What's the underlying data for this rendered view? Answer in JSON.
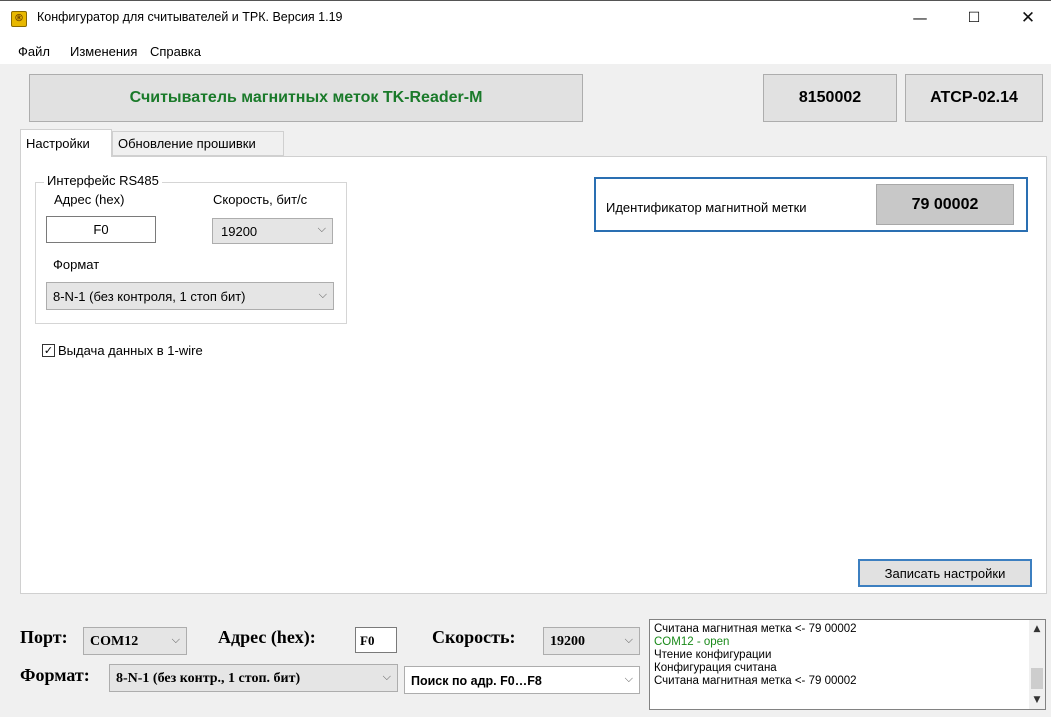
{
  "window": {
    "title": "Конфигуратор  для считывателей и ТРК.  Версия 1.19",
    "icon": "app-logo-icon",
    "minimize_glyph": "—",
    "maximize_glyph": "☐",
    "close_glyph": "✕"
  },
  "menu": {
    "file": "Файл",
    "edit": "Изменения",
    "help": "Справка"
  },
  "header": {
    "device_name": "Считыватель магнитных меток TK-Reader-M",
    "device_name_color": "#1a7a2a",
    "serial": "8150002",
    "version": "ATCP-02.14"
  },
  "tabs": [
    {
      "label": "Настройки",
      "active": true
    },
    {
      "label": "Обновление прошивки",
      "active": false
    }
  ],
  "settings": {
    "rs485_group": "Интерфейс RS485",
    "address_label": "Адрес (hex)",
    "address_value": "F0",
    "speed_label": "Скорость, бит/с",
    "speed_value": "19200",
    "format_label": "Формат",
    "format_value": "8-N-1 (без контроля, 1 стоп бит)",
    "onewire_label": "Выдача данных в 1-wire",
    "onewire_checked": true,
    "tag_label": "Идентификатор магнитной метки",
    "tag_value": "79 00002",
    "write_button": "Записать настройки"
  },
  "bottom": {
    "port_label": "Порт:",
    "port_value": "COM12",
    "address_label": "Адрес (hex):",
    "address_value": "F0",
    "speed_label": "Скорость:",
    "speed_value": "19200",
    "format_label": "Формат:",
    "format_value": "8-N-1 (без контр., 1 стоп. бит)",
    "search_value": "Поиск по адр. F0…F8"
  },
  "log": [
    {
      "text": "Считана магнитная метка <- 79 00002",
      "color": "#000000"
    },
    {
      "text": "COM12 - open",
      "color": "#1a8a1a"
    },
    {
      "text": "Чтение конфигурации",
      "color": "#000000"
    },
    {
      "text": "Конфигурация считана",
      "color": "#000000"
    },
    {
      "text": "Считана магнитная метка <- 79 00002",
      "color": "#000000"
    }
  ],
  "chevron_glyph": "⌵",
  "check_glyph": "✓",
  "scroll_up_glyph": "▲",
  "scroll_down_glyph": "▼"
}
